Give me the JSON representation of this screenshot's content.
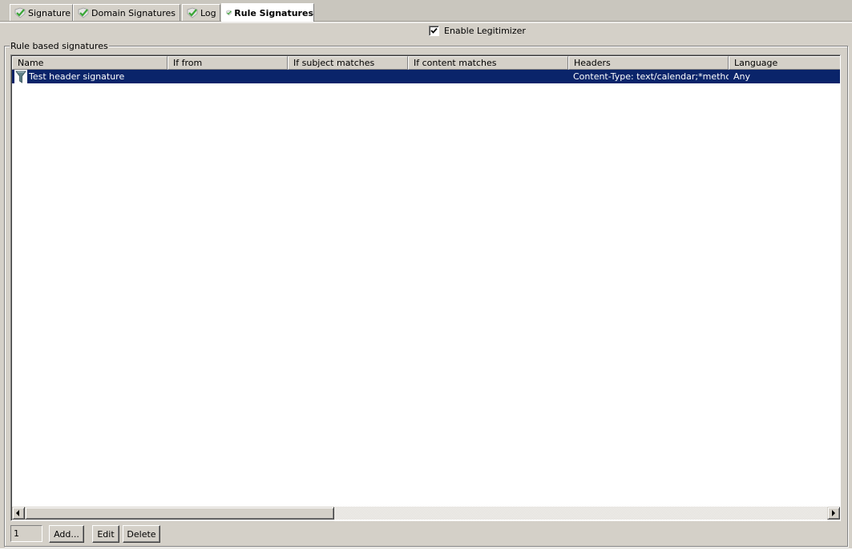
{
  "tabs": [
    {
      "label": "Signature",
      "icon": "check-shield-icon",
      "active": false
    },
    {
      "label": "Domain Signatures",
      "icon": "check-shield-icon",
      "active": false
    },
    {
      "label": "Log",
      "icon": "check-shield-icon",
      "active": false
    },
    {
      "label": "Rule Signatures",
      "icon": "check-shield-icon",
      "active": true
    }
  ],
  "enable_legitimizer": {
    "label": "Enable Legitimizer",
    "checked": true
  },
  "group": {
    "label": "Rule based signatures"
  },
  "list": {
    "columns": [
      "Name",
      "If from",
      "If subject matches",
      "If content matches",
      "Headers",
      "Language"
    ],
    "rows": [
      {
        "icon": "funnel-filter-icon",
        "selected": true,
        "cells": [
          "Test header signature",
          "",
          "",
          "",
          "Content-Type: text/calendar;*method...",
          "Any"
        ]
      }
    ]
  },
  "footer": {
    "count": "1",
    "add_label": "Add...",
    "edit_label": "Edit",
    "delete_label": "Delete"
  },
  "colors": {
    "selection": "#0a246a",
    "face": "#d4d0c8",
    "check_green": "#3aa635"
  }
}
